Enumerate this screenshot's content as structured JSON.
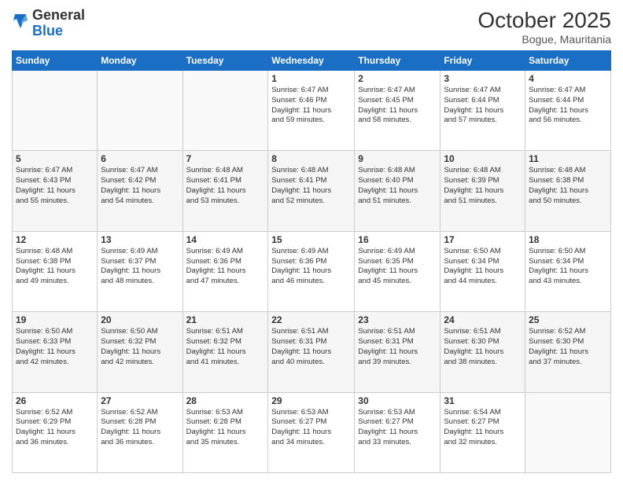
{
  "header": {
    "month_title": "October 2025",
    "location": "Bogue, Mauritania"
  },
  "calendar": {
    "days": [
      "Sunday",
      "Monday",
      "Tuesday",
      "Wednesday",
      "Thursday",
      "Friday",
      "Saturday"
    ]
  },
  "weeks": [
    [
      {
        "num": "",
        "info": ""
      },
      {
        "num": "",
        "info": ""
      },
      {
        "num": "",
        "info": ""
      },
      {
        "num": "1",
        "info": "Sunrise: 6:47 AM\nSunset: 6:46 PM\nDaylight: 11 hours\nand 59 minutes."
      },
      {
        "num": "2",
        "info": "Sunrise: 6:47 AM\nSunset: 6:45 PM\nDaylight: 11 hours\nand 58 minutes."
      },
      {
        "num": "3",
        "info": "Sunrise: 6:47 AM\nSunset: 6:44 PM\nDaylight: 11 hours\nand 57 minutes."
      },
      {
        "num": "4",
        "info": "Sunrise: 6:47 AM\nSunset: 6:44 PM\nDaylight: 11 hours\nand 56 minutes."
      }
    ],
    [
      {
        "num": "5",
        "info": "Sunrise: 6:47 AM\nSunset: 6:43 PM\nDaylight: 11 hours\nand 55 minutes."
      },
      {
        "num": "6",
        "info": "Sunrise: 6:47 AM\nSunset: 6:42 PM\nDaylight: 11 hours\nand 54 minutes."
      },
      {
        "num": "7",
        "info": "Sunrise: 6:48 AM\nSunset: 6:41 PM\nDaylight: 11 hours\nand 53 minutes."
      },
      {
        "num": "8",
        "info": "Sunrise: 6:48 AM\nSunset: 6:41 PM\nDaylight: 11 hours\nand 52 minutes."
      },
      {
        "num": "9",
        "info": "Sunrise: 6:48 AM\nSunset: 6:40 PM\nDaylight: 11 hours\nand 51 minutes."
      },
      {
        "num": "10",
        "info": "Sunrise: 6:48 AM\nSunset: 6:39 PM\nDaylight: 11 hours\nand 51 minutes."
      },
      {
        "num": "11",
        "info": "Sunrise: 6:48 AM\nSunset: 6:38 PM\nDaylight: 11 hours\nand 50 minutes."
      }
    ],
    [
      {
        "num": "12",
        "info": "Sunrise: 6:48 AM\nSunset: 6:38 PM\nDaylight: 11 hours\nand 49 minutes."
      },
      {
        "num": "13",
        "info": "Sunrise: 6:49 AM\nSunset: 6:37 PM\nDaylight: 11 hours\nand 48 minutes."
      },
      {
        "num": "14",
        "info": "Sunrise: 6:49 AM\nSunset: 6:36 PM\nDaylight: 11 hours\nand 47 minutes."
      },
      {
        "num": "15",
        "info": "Sunrise: 6:49 AM\nSunset: 6:36 PM\nDaylight: 11 hours\nand 46 minutes."
      },
      {
        "num": "16",
        "info": "Sunrise: 6:49 AM\nSunset: 6:35 PM\nDaylight: 11 hours\nand 45 minutes."
      },
      {
        "num": "17",
        "info": "Sunrise: 6:50 AM\nSunset: 6:34 PM\nDaylight: 11 hours\nand 44 minutes."
      },
      {
        "num": "18",
        "info": "Sunrise: 6:50 AM\nSunset: 6:34 PM\nDaylight: 11 hours\nand 43 minutes."
      }
    ],
    [
      {
        "num": "19",
        "info": "Sunrise: 6:50 AM\nSunset: 6:33 PM\nDaylight: 11 hours\nand 42 minutes."
      },
      {
        "num": "20",
        "info": "Sunrise: 6:50 AM\nSunset: 6:32 PM\nDaylight: 11 hours\nand 42 minutes."
      },
      {
        "num": "21",
        "info": "Sunrise: 6:51 AM\nSunset: 6:32 PM\nDaylight: 11 hours\nand 41 minutes."
      },
      {
        "num": "22",
        "info": "Sunrise: 6:51 AM\nSunset: 6:31 PM\nDaylight: 11 hours\nand 40 minutes."
      },
      {
        "num": "23",
        "info": "Sunrise: 6:51 AM\nSunset: 6:31 PM\nDaylight: 11 hours\nand 39 minutes."
      },
      {
        "num": "24",
        "info": "Sunrise: 6:51 AM\nSunset: 6:30 PM\nDaylight: 11 hours\nand 38 minutes."
      },
      {
        "num": "25",
        "info": "Sunrise: 6:52 AM\nSunset: 6:30 PM\nDaylight: 11 hours\nand 37 minutes."
      }
    ],
    [
      {
        "num": "26",
        "info": "Sunrise: 6:52 AM\nSunset: 6:29 PM\nDaylight: 11 hours\nand 36 minutes."
      },
      {
        "num": "27",
        "info": "Sunrise: 6:52 AM\nSunset: 6:28 PM\nDaylight: 11 hours\nand 36 minutes."
      },
      {
        "num": "28",
        "info": "Sunrise: 6:53 AM\nSunset: 6:28 PM\nDaylight: 11 hours\nand 35 minutes."
      },
      {
        "num": "29",
        "info": "Sunrise: 6:53 AM\nSunset: 6:27 PM\nDaylight: 11 hours\nand 34 minutes."
      },
      {
        "num": "30",
        "info": "Sunrise: 6:53 AM\nSunset: 6:27 PM\nDaylight: 11 hours\nand 33 minutes."
      },
      {
        "num": "31",
        "info": "Sunrise: 6:54 AM\nSunset: 6:27 PM\nDaylight: 11 hours\nand 32 minutes."
      },
      {
        "num": "",
        "info": ""
      }
    ]
  ]
}
